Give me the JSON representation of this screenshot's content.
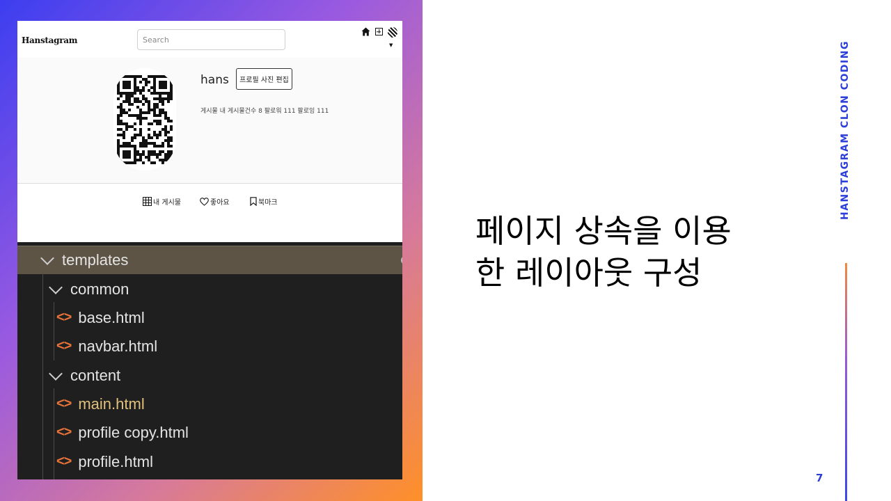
{
  "app": {
    "brand": "Hanstagram",
    "search": {
      "placeholder": "Search"
    },
    "icons": [
      "home-icon",
      "add-post-icon",
      "profile-avatar-icon",
      "caret-down-icon"
    ]
  },
  "profile": {
    "username": "hans",
    "edit_button": "프로필 사진 편집",
    "stats": "게시물 내 게시물건수 8 팔로워 111 팔로잉 111"
  },
  "tabs": [
    {
      "label": "내 게시물",
      "icon": "grid-icon"
    },
    {
      "label": "좋아요",
      "icon": "heart-icon"
    },
    {
      "label": "북마크",
      "icon": "bookmark-icon"
    }
  ],
  "explorer": {
    "folders": [
      "templates",
      "common",
      "content"
    ],
    "files": [
      "base.html",
      "navbar.html",
      "main.html",
      "profile copy.html",
      "profile.html"
    ],
    "file_icon": "<>",
    "main_status": "M",
    "colors": {
      "selected_row": "#5d5445",
      "icon": "#e8743a",
      "modified": "#d6b36e"
    }
  },
  "slide": {
    "headline_line1": "페이지 상속을 이용",
    "headline_line2": "한 레이아웃 구성",
    "vertical_label": "HANSTAGRAM  CLON CODING",
    "page_number": "7",
    "accent": "#2c3fd6"
  }
}
